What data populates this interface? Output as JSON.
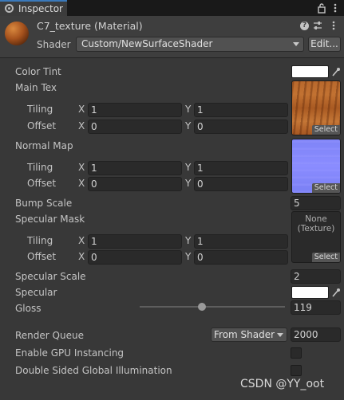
{
  "tab": {
    "title": "Inspector",
    "icons": [
      "info-icon",
      "lock-icon",
      "more-icon"
    ]
  },
  "header": {
    "title": "C7_texture (Material)",
    "shader_label": "Shader",
    "shader_value": "Custom/NewSurfaceShader",
    "edit_label": "Edit...",
    "help_glyph": "?"
  },
  "props": {
    "color_tint": {
      "label": "Color Tint",
      "color": "#ffffff"
    },
    "main_tex": {
      "label": "Main Tex",
      "tiling_label": "Tiling",
      "offset_label": "Offset",
      "tiling": {
        "x": "1",
        "y": "1"
      },
      "offset": {
        "x": "0",
        "y": "0"
      },
      "select_label": "Select"
    },
    "normal_map": {
      "label": "Normal Map",
      "tiling_label": "Tiling",
      "offset_label": "Offset",
      "tiling": {
        "x": "1",
        "y": "1"
      },
      "offset": {
        "x": "0",
        "y": "0"
      },
      "select_label": "Select"
    },
    "bump_scale": {
      "label": "Bump Scale",
      "value": "5"
    },
    "specular_mask": {
      "label": "Specular Mask",
      "tiling_label": "Tiling",
      "offset_label": "Offset",
      "tiling": {
        "x": "1",
        "y": "1"
      },
      "offset": {
        "x": "0",
        "y": "0"
      },
      "none_line1": "None",
      "none_line2": "(Texture)",
      "select_label": "Select"
    },
    "specular_scale": {
      "label": "Specular Scale",
      "value": "2"
    },
    "specular": {
      "label": "Specular",
      "color": "#ffffff"
    },
    "gloss": {
      "label": "Gloss",
      "value": "119",
      "slider_fraction": 0.43
    },
    "render_queue": {
      "label": "Render Queue",
      "mode": "From Shader",
      "value": "2000"
    },
    "gpu_instancing": {
      "label": "Enable GPU Instancing",
      "checked": false
    },
    "double_sided_gi": {
      "label": "Double Sided Global Illumination",
      "checked": false
    }
  },
  "axis": {
    "x": "X",
    "y": "Y"
  },
  "watermark": "CSDN @YY_oot",
  "colors": {
    "accent": "#3a79bb",
    "background": "#383838",
    "field": "#2a2a2a"
  }
}
